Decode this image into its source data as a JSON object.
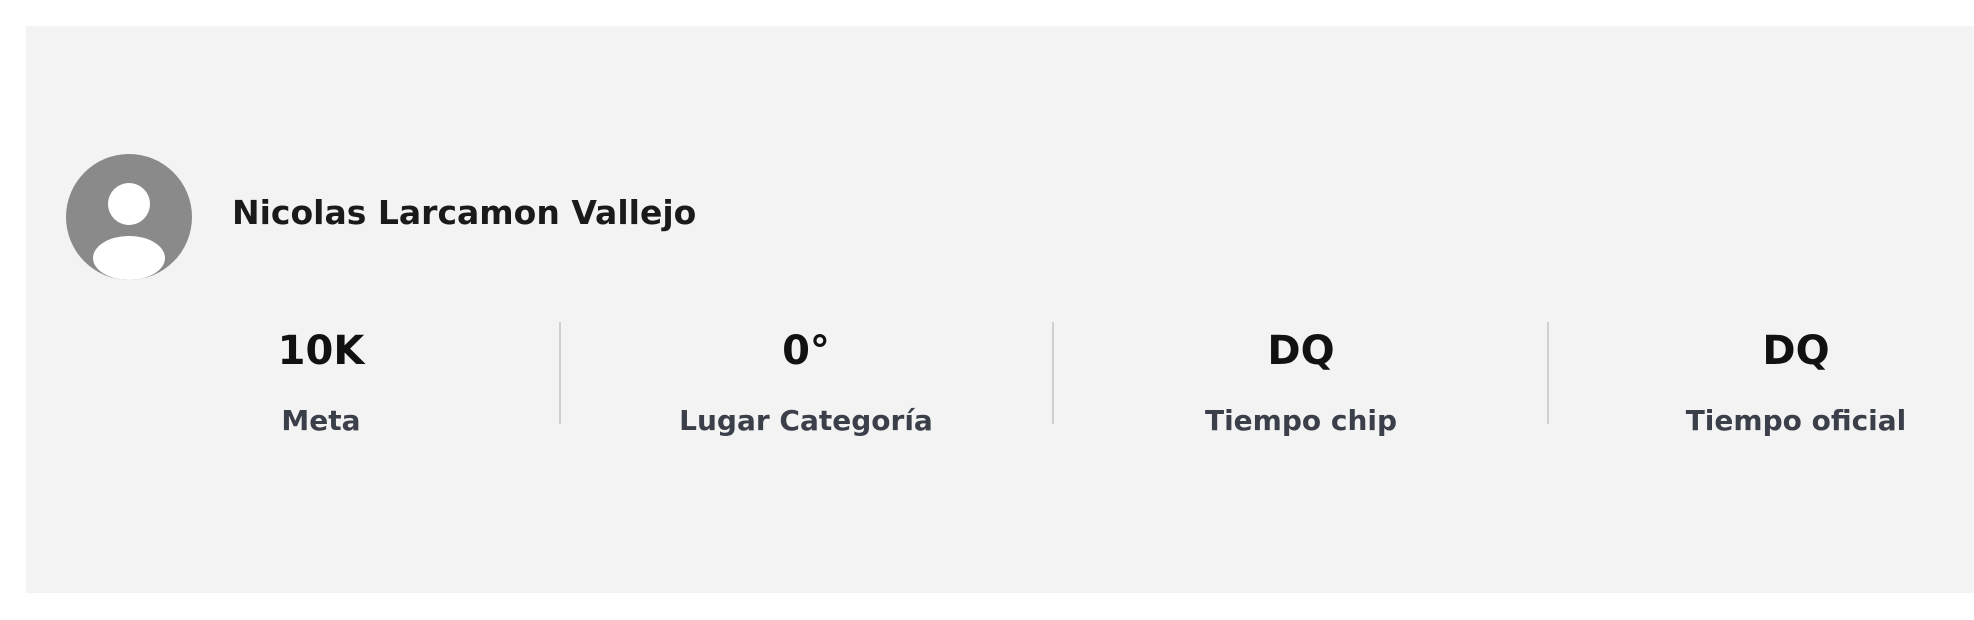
{
  "runner": {
    "name": "Nicolas Larcamon Vallejo",
    "avatar_icon": "user-placeholder-icon"
  },
  "stats": [
    {
      "value": "10K",
      "label": "Meta"
    },
    {
      "value": "0°",
      "label": "Lugar Categoría"
    },
    {
      "value": "DQ",
      "label": "Tiempo chip"
    },
    {
      "value": "DQ",
      "label": "Tiempo oficial"
    }
  ],
  "colors": {
    "card_background": "#f3f3f3",
    "avatar_background": "#8a8a8a",
    "label_text": "#3a3f4a"
  }
}
